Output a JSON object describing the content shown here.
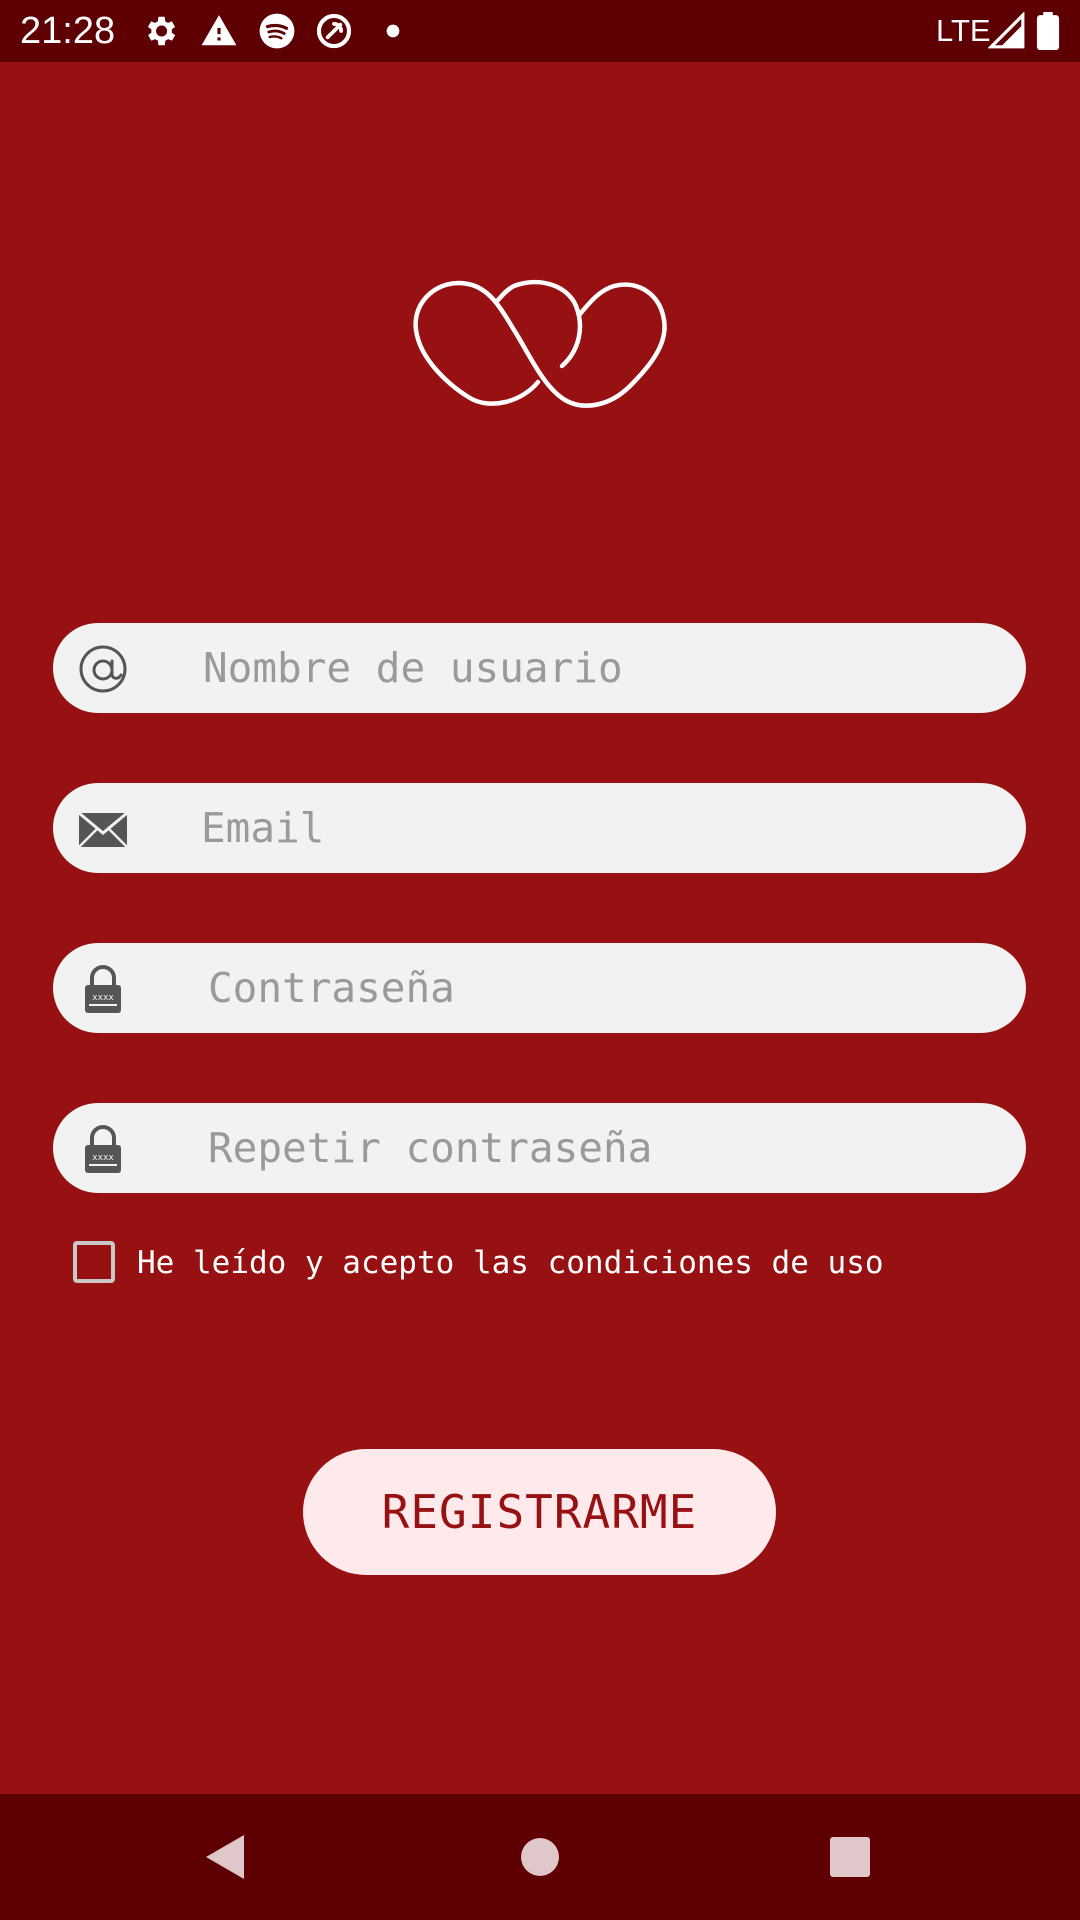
{
  "status_bar": {
    "time": "21:28",
    "network": "LTE",
    "icons": [
      "settings-icon",
      "warning-icon",
      "spotify-icon",
      "sync-icon",
      "notification-dot-icon",
      "signal-icon",
      "battery-icon"
    ]
  },
  "logo": {
    "icon": "double-heart-logo"
  },
  "form": {
    "username": {
      "placeholder": "Nombre de usuario",
      "value": "",
      "icon": "at-icon"
    },
    "email": {
      "placeholder": "Email",
      "value": "",
      "icon": "envelope-icon"
    },
    "password": {
      "placeholder": "Contraseña",
      "value": "",
      "icon": "lock-icon"
    },
    "repeat_password": {
      "placeholder": "Repetir contraseña",
      "value": "",
      "icon": "lock-icon"
    },
    "terms": {
      "label": "He leído y acepto las condiciones de uso",
      "checked": false
    },
    "submit_label": "REGISTRARME"
  },
  "nav_bar": {
    "buttons": [
      "back-icon",
      "home-icon",
      "recents-icon"
    ]
  },
  "colors": {
    "background": "#971012",
    "system_bars": "#5e0003",
    "field_background": "#f2f2f3",
    "button_background": "#ffe9ea",
    "button_text": "#971012"
  }
}
